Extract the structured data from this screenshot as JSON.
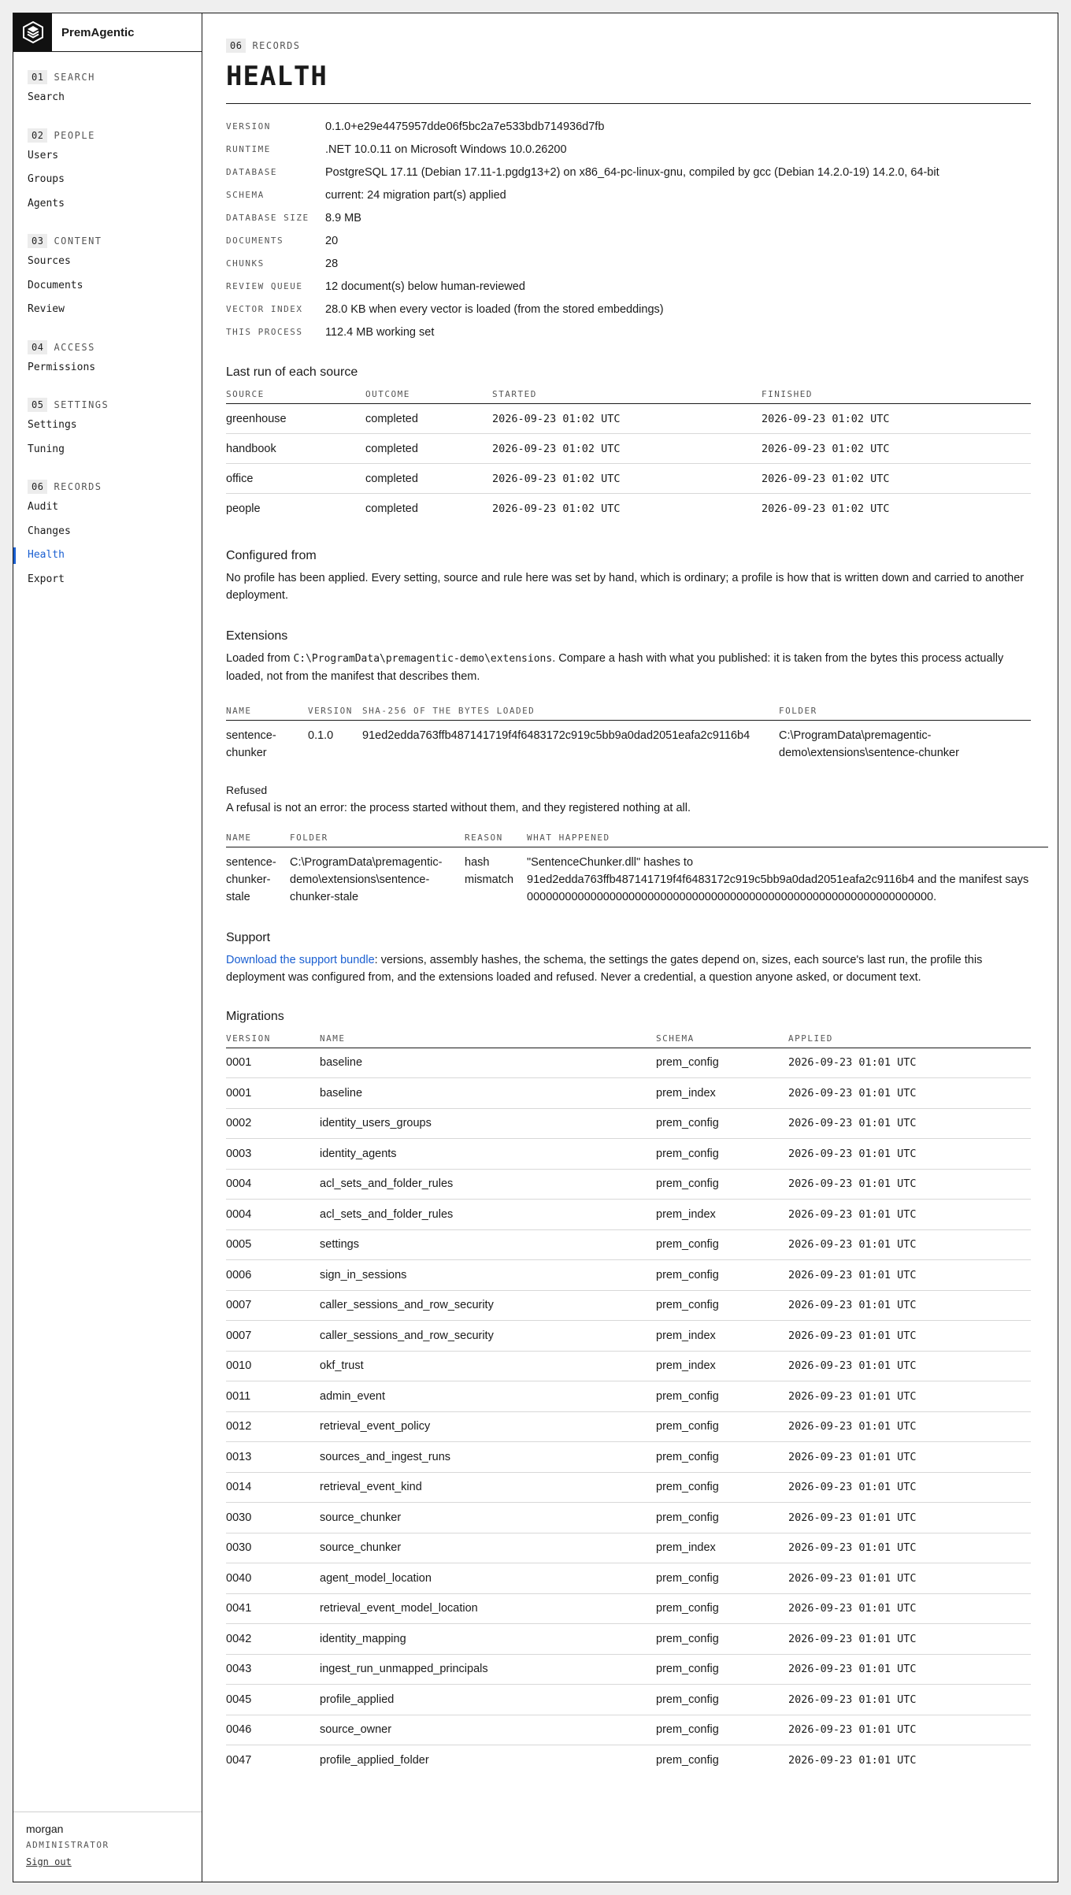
{
  "app": {
    "name": "PremAgentic"
  },
  "sidebar": {
    "sections": [
      {
        "num": "01",
        "title": "SEARCH",
        "items": [
          "Search"
        ]
      },
      {
        "num": "02",
        "title": "PEOPLE",
        "items": [
          "Users",
          "Groups",
          "Agents"
        ]
      },
      {
        "num": "03",
        "title": "CONTENT",
        "items": [
          "Sources",
          "Documents",
          "Review"
        ]
      },
      {
        "num": "04",
        "title": "ACCESS",
        "items": [
          "Permissions"
        ]
      },
      {
        "num": "05",
        "title": "SETTINGS",
        "items": [
          "Settings",
          "Tuning"
        ]
      },
      {
        "num": "06",
        "title": "RECORDS",
        "items": [
          "Audit",
          "Changes",
          "Health",
          "Export"
        ]
      }
    ],
    "active_item": "Health",
    "user": {
      "name": "morgan",
      "role": "ADMINISTRATOR",
      "signout": "Sign out"
    }
  },
  "page": {
    "eyebrow_num": "06",
    "eyebrow_label": "RECORDS",
    "title": "HEALTH"
  },
  "info": [
    {
      "key": "VERSION",
      "value": "0.1.0+e29e4475957dde06f5bc2a7e533bdb714936d7fb"
    },
    {
      "key": "RUNTIME",
      "value": ".NET 10.0.11 on Microsoft Windows 10.0.26200"
    },
    {
      "key": "DATABASE",
      "value": "PostgreSQL 17.11 (Debian 17.11-1.pgdg13+2) on x86_64-pc-linux-gnu, compiled by gcc (Debian 14.2.0-19) 14.2.0, 64-bit"
    },
    {
      "key": "SCHEMA",
      "value": "current: 24 migration part(s) applied"
    },
    {
      "key": "DATABASE SIZE",
      "value": "8.9 MB"
    },
    {
      "key": "DOCUMENTS",
      "value": "20"
    },
    {
      "key": "CHUNKS",
      "value": "28"
    },
    {
      "key": "REVIEW QUEUE",
      "value": "12 document(s) below human-reviewed"
    },
    {
      "key": "VECTOR INDEX",
      "value": "28.0 KB when every vector is loaded (from the stored embeddings)"
    },
    {
      "key": "THIS PROCESS",
      "value": "112.4 MB working set"
    }
  ],
  "runs": {
    "title": "Last run of each source",
    "headers": [
      "SOURCE",
      "OUTCOME",
      "STARTED",
      "FINISHED"
    ],
    "rows": [
      [
        "greenhouse",
        "completed",
        "2026-09-23 01:02 UTC",
        "2026-09-23 01:02 UTC"
      ],
      [
        "handbook",
        "completed",
        "2026-09-23 01:02 UTC",
        "2026-09-23 01:02 UTC"
      ],
      [
        "office",
        "completed",
        "2026-09-23 01:02 UTC",
        "2026-09-23 01:02 UTC"
      ],
      [
        "people",
        "completed",
        "2026-09-23 01:02 UTC",
        "2026-09-23 01:02 UTC"
      ]
    ]
  },
  "configured": {
    "title": "Configured from",
    "text": "No profile has been applied. Every setting, source and rule here was set by hand, which is ordinary; a profile is how that is written down and carried to another deployment."
  },
  "extensions": {
    "title": "Extensions",
    "text_before": "Loaded from ",
    "path": "C:\\ProgramData\\premagentic-demo\\extensions",
    "text_after": ". Compare a hash with what you published: it is taken from the bytes this process actually loaded, not from the manifest that describes them.",
    "headers": [
      "NAME",
      "VERSION",
      "SHA-256 OF THE BYTES LOADED",
      "FOLDER"
    ],
    "rows": [
      [
        "sentence-chunker",
        "0.1.0",
        "91ed2edda763ffb487141719f4f6483172c919c5bb9a0dad2051eafa2c9116b4",
        "C:\\ProgramData\\premagentic-demo\\extensions\\sentence-chunker"
      ]
    ]
  },
  "refused": {
    "title": "Refused",
    "text": "A refusal is not an error: the process started without them, and they registered nothing at all.",
    "headers": [
      "NAME",
      "FOLDER",
      "REASON",
      "WHAT HAPPENED"
    ],
    "rows": [
      [
        "sentence-chunker-stale",
        "C:\\ProgramData\\premagentic-demo\\extensions\\sentence-chunker-stale",
        "hash mismatch",
        "\"SentenceChunker.dll\" hashes to 91ed2edda763ffb487141719f4f6483172c919c5bb9a0dad2051eafa2c9116b4 and the manifest says 0000000000000000000000000000000000000000000000000000000000000000."
      ]
    ]
  },
  "support": {
    "title": "Support",
    "link": "Download the support bundle",
    "text": ": versions, assembly hashes, the schema, the settings the gates depend on, sizes, each source's last run, the profile this deployment was configured from, and the extensions loaded and refused. Never a credential, a question anyone asked, or document text."
  },
  "migrations": {
    "title": "Migrations",
    "headers": [
      "VERSION",
      "NAME",
      "SCHEMA",
      "APPLIED"
    ],
    "rows": [
      [
        "0001",
        "baseline",
        "prem_config",
        "2026-09-23 01:01 UTC"
      ],
      [
        "0001",
        "baseline",
        "prem_index",
        "2026-09-23 01:01 UTC"
      ],
      [
        "0002",
        "identity_users_groups",
        "prem_config",
        "2026-09-23 01:01 UTC"
      ],
      [
        "0003",
        "identity_agents",
        "prem_config",
        "2026-09-23 01:01 UTC"
      ],
      [
        "0004",
        "acl_sets_and_folder_rules",
        "prem_config",
        "2026-09-23 01:01 UTC"
      ],
      [
        "0004",
        "acl_sets_and_folder_rules",
        "prem_index",
        "2026-09-23 01:01 UTC"
      ],
      [
        "0005",
        "settings",
        "prem_config",
        "2026-09-23 01:01 UTC"
      ],
      [
        "0006",
        "sign_in_sessions",
        "prem_config",
        "2026-09-23 01:01 UTC"
      ],
      [
        "0007",
        "caller_sessions_and_row_security",
        "prem_config",
        "2026-09-23 01:01 UTC"
      ],
      [
        "0007",
        "caller_sessions_and_row_security",
        "prem_index",
        "2026-09-23 01:01 UTC"
      ],
      [
        "0010",
        "okf_trust",
        "prem_index",
        "2026-09-23 01:01 UTC"
      ],
      [
        "0011",
        "admin_event",
        "prem_config",
        "2026-09-23 01:01 UTC"
      ],
      [
        "0012",
        "retrieval_event_policy",
        "prem_config",
        "2026-09-23 01:01 UTC"
      ],
      [
        "0013",
        "sources_and_ingest_runs",
        "prem_config",
        "2026-09-23 01:01 UTC"
      ],
      [
        "0014",
        "retrieval_event_kind",
        "prem_config",
        "2026-09-23 01:01 UTC"
      ],
      [
        "0030",
        "source_chunker",
        "prem_config",
        "2026-09-23 01:01 UTC"
      ],
      [
        "0030",
        "source_chunker",
        "prem_index",
        "2026-09-23 01:01 UTC"
      ],
      [
        "0040",
        "agent_model_location",
        "prem_config",
        "2026-09-23 01:01 UTC"
      ],
      [
        "0041",
        "retrieval_event_model_location",
        "prem_config",
        "2026-09-23 01:01 UTC"
      ],
      [
        "0042",
        "identity_mapping",
        "prem_config",
        "2026-09-23 01:01 UTC"
      ],
      [
        "0043",
        "ingest_run_unmapped_principals",
        "prem_config",
        "2026-09-23 01:01 UTC"
      ],
      [
        "0045",
        "profile_applied",
        "prem_config",
        "2026-09-23 01:01 UTC"
      ],
      [
        "0046",
        "source_owner",
        "prem_config",
        "2026-09-23 01:01 UTC"
      ],
      [
        "0047",
        "profile_applied_folder",
        "prem_config",
        "2026-09-23 01:01 UTC"
      ]
    ]
  },
  "colors": {
    "accent": "#1a5fd1",
    "ink": "#1a1a1a",
    "muted": "#555555"
  },
  "icons": {
    "brand": "cube-logo-icon"
  }
}
